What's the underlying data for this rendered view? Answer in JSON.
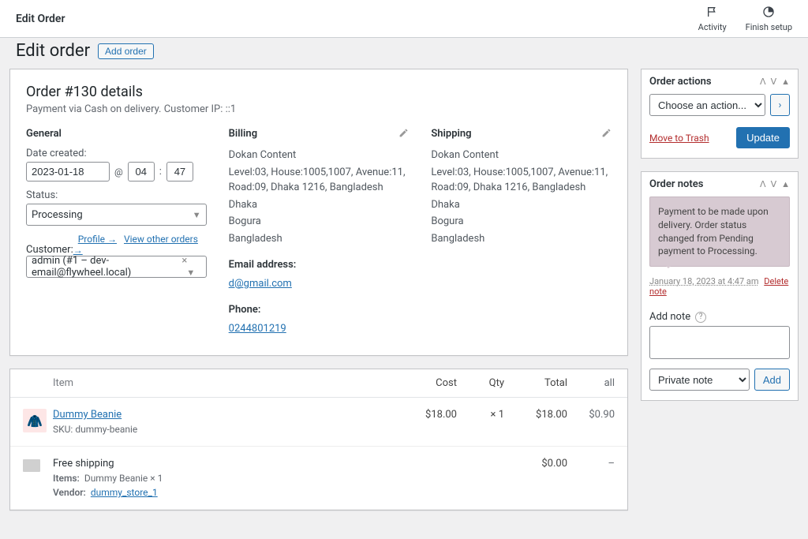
{
  "topbar": {
    "title": "Edit Order",
    "activity": "Activity",
    "finish": "Finish setup"
  },
  "pagehead": {
    "heading": "Edit order",
    "add_order": "Add order"
  },
  "order": {
    "title": "Order #130 details",
    "subtitle": "Payment via Cash on delivery. Customer IP: ::1",
    "general": {
      "heading": "General",
      "date_label": "Date created:",
      "date": "2023-01-18",
      "at": "@",
      "hour": "04",
      "colon": ":",
      "minute": "47",
      "status_label": "Status:",
      "status_value": "Processing",
      "customer_label": "Customer:",
      "profile_link": "Profile →",
      "other_orders_link": "View other orders →",
      "customer_value": "admin (#1 – dev-email@flywheel.local)"
    },
    "billing": {
      "heading": "Billing",
      "name": "Dokan Content",
      "line1": "Level:03, House:1005,1007, Avenue:11, Road:09, Dhaka 1216, Bangladesh",
      "city": "Dhaka",
      "district": "Bogura",
      "country": "Bangladesh",
      "email_label": "Email address:",
      "email": "d@gmail.com",
      "phone_label": "Phone:",
      "phone": "0244801219"
    },
    "shipping": {
      "heading": "Shipping",
      "name": "Dokan Content",
      "line1": "Level:03, House:1005,1007, Avenue:11, Road:09, Dhaka 1216, Bangladesh",
      "city": "Dhaka",
      "district": "Bogura",
      "country": "Bangladesh"
    }
  },
  "items": {
    "head": {
      "item": "Item",
      "cost": "Cost",
      "qty": "Qty",
      "total": "Total",
      "all": "all"
    },
    "rows": [
      {
        "name": "Dummy Beanie",
        "sku_label": "SKU:",
        "sku": "dummy-beanie",
        "cost": "$18.00",
        "qty": "× 1",
        "total": "$18.00",
        "all": "$0.90"
      }
    ],
    "shipping": {
      "name": "Free shipping",
      "items_label": "Items:",
      "items_value": "Dummy Beanie × 1",
      "vendor_label": "Vendor:",
      "vendor_link": "dummy_store_1",
      "total": "$0.00",
      "all": "–"
    }
  },
  "sidebar": {
    "actions": {
      "title": "Order actions",
      "choose": "Choose an action...",
      "trash": "Move to Trash",
      "update": "Update"
    },
    "notes": {
      "title": "Order notes",
      "note_text": "Payment to be made upon delivery. Order status changed from Pending payment to Processing.",
      "note_time": "January 18, 2023 at 4:47 am",
      "delete": "Delete note",
      "add_label": "Add note",
      "note_type": "Private note",
      "add_btn": "Add"
    }
  }
}
